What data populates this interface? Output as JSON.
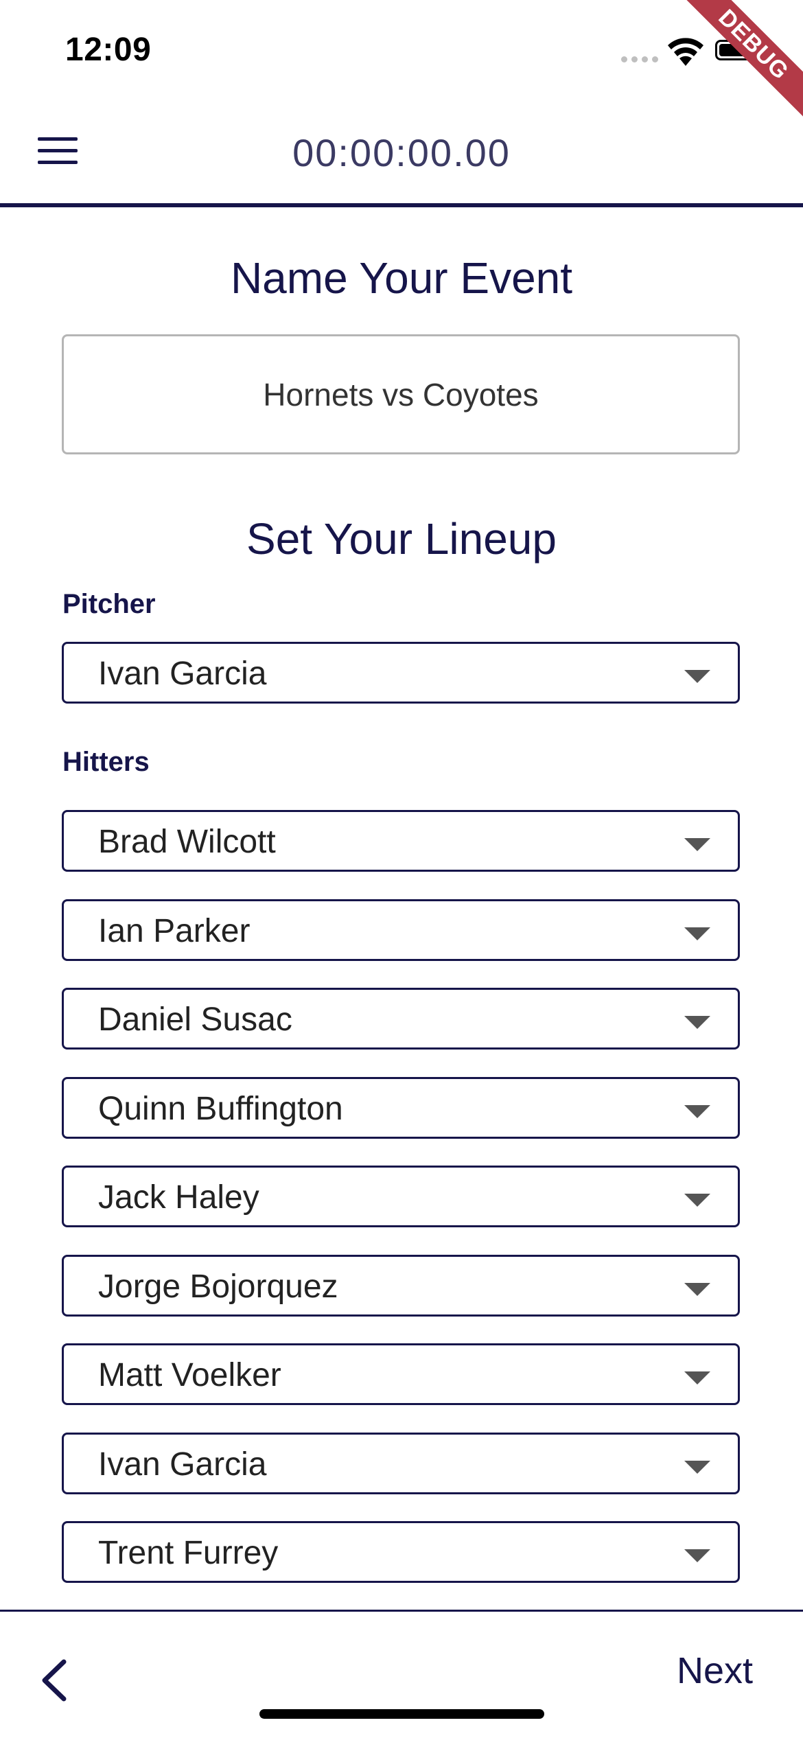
{
  "status_bar": {
    "time": "12:09",
    "debug_label": "DEBUG"
  },
  "app_bar": {
    "timer": "00:00:00.00",
    "menu_icon": "hamburger-menu-icon"
  },
  "event": {
    "title": "Name Your Event",
    "name_value": "Hornets vs Coyotes"
  },
  "lineup": {
    "title": "Set Your Lineup",
    "pitcher_label": "Pitcher",
    "pitcher": "Ivan Garcia",
    "hitters_label": "Hitters",
    "hitters": [
      "Brad Wilcott",
      "Ian Parker",
      "Daniel Susac",
      "Quinn Buffington",
      "Jack Haley",
      "Jorge Bojorquez",
      "Matt Voelker",
      "Ivan Garcia",
      "Trent Furrey"
    ]
  },
  "bottom_bar": {
    "back_icon": "chevron-left-icon",
    "next_label": "Next"
  },
  "colors": {
    "primary": "#16154a",
    "debug_banner": "#b33a47",
    "input_border": "#b5b5b5"
  }
}
